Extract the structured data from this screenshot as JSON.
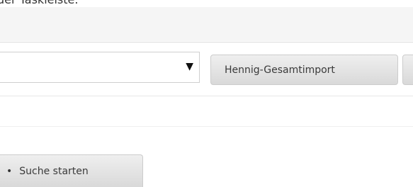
{
  "caption": {
    "text": "der Taskleiste."
  },
  "select": {
    "value": "",
    "arrow_icon": "dropdown-triangle-icon"
  },
  "buttons": {
    "import_label": "Hennig-Gesamtimport",
    "partial_label": "",
    "search_label": "Suche starten",
    "search_bullet": "•"
  }
}
